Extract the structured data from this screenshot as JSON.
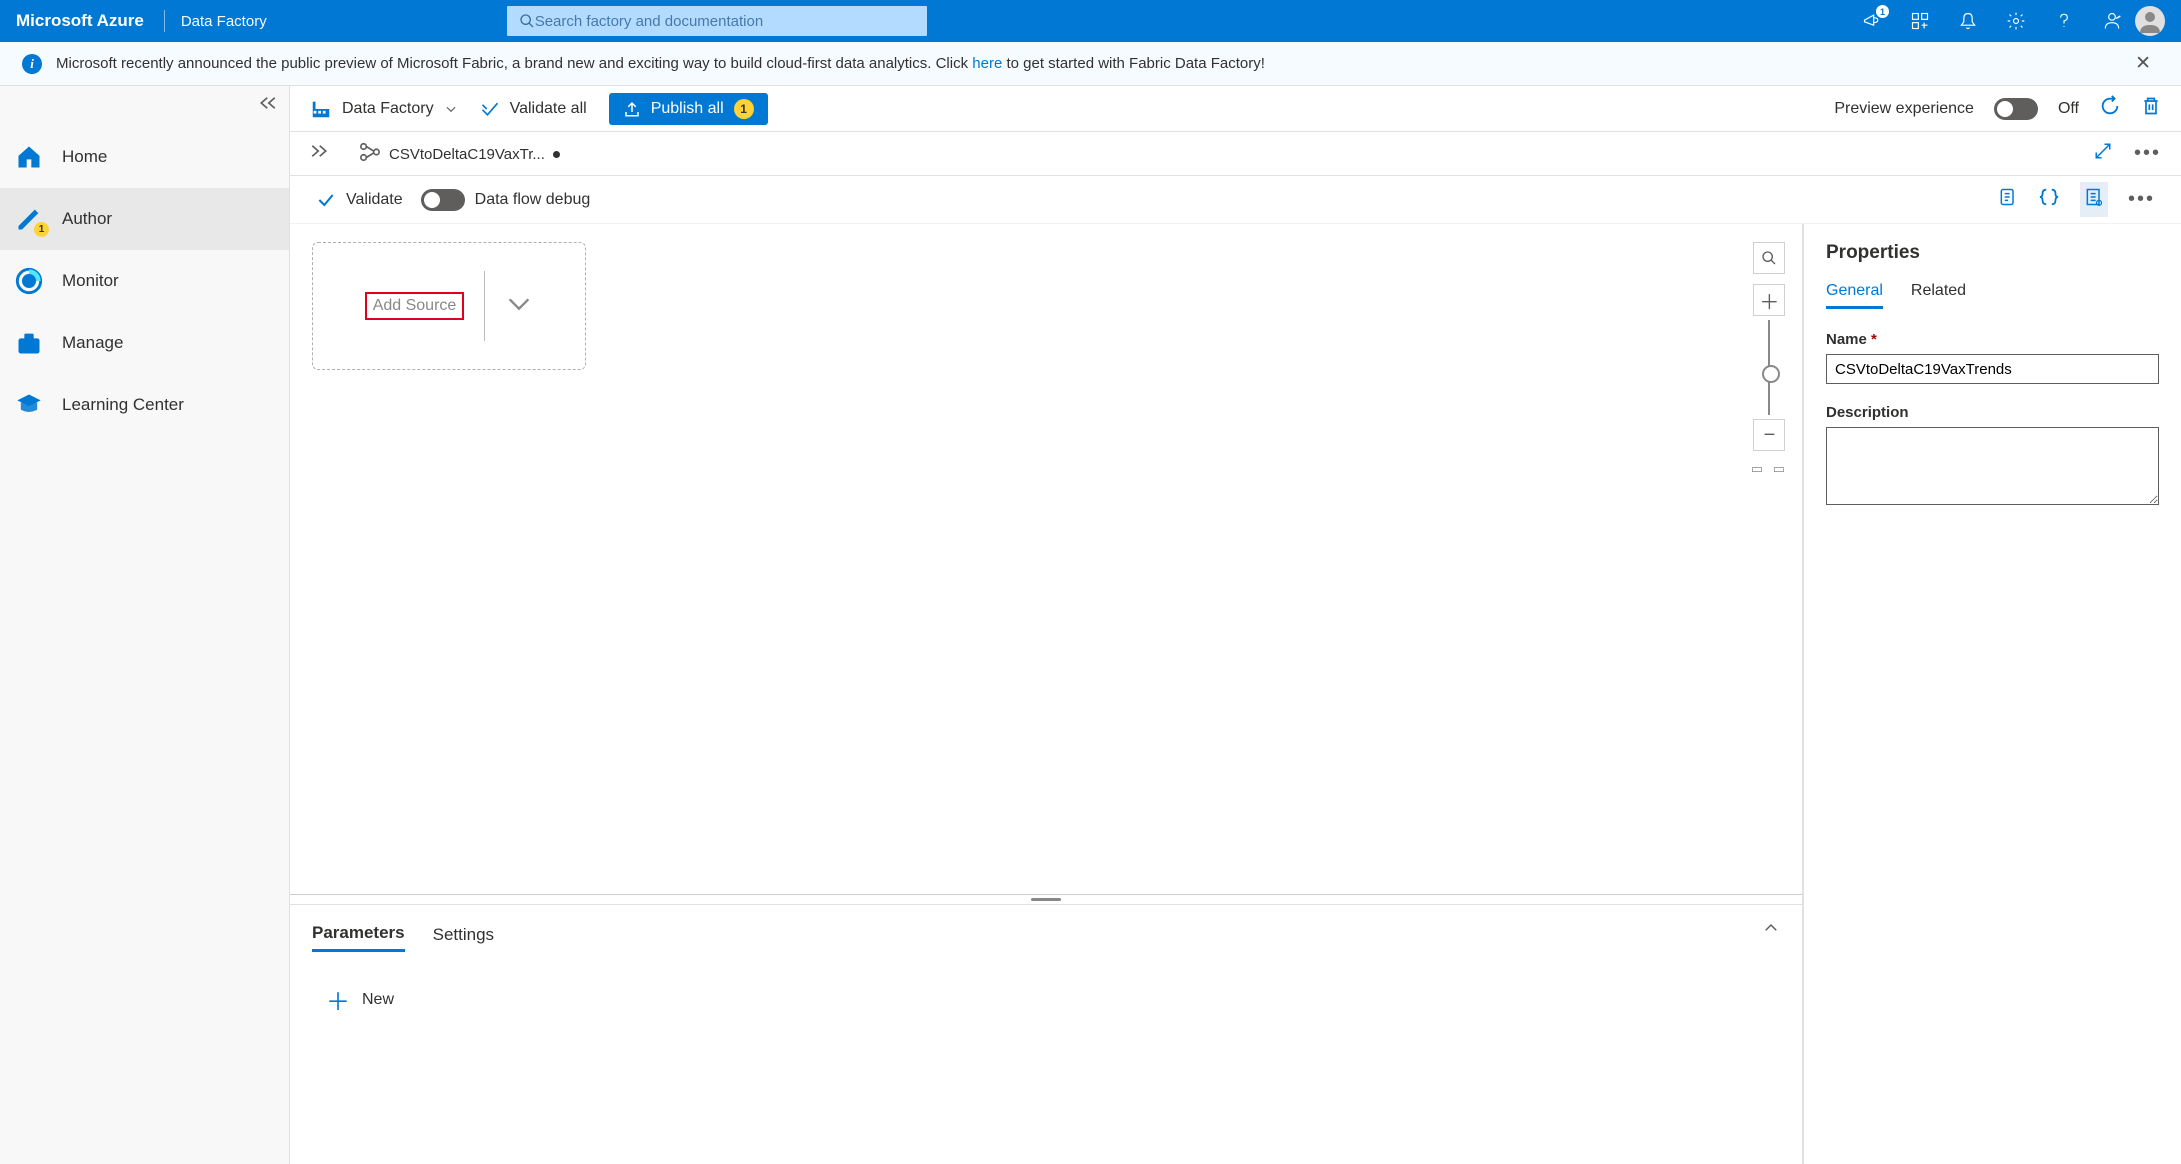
{
  "header": {
    "brand": "Microsoft Azure",
    "product": "Data Factory",
    "search_placeholder": "Search factory and documentation",
    "notification_badge": "1"
  },
  "banner": {
    "text_before": "Microsoft recently announced the public preview of Microsoft Fabric, a brand new and exciting way to build cloud-first data analytics. Click ",
    "link": "here",
    "text_after": " to get started with Fabric Data Factory!"
  },
  "sidebar": {
    "items": [
      {
        "label": "Home"
      },
      {
        "label": "Author",
        "badge": "1"
      },
      {
        "label": "Monitor"
      },
      {
        "label": "Manage"
      },
      {
        "label": "Learning Center"
      }
    ]
  },
  "toolbar": {
    "breadcrumb": "Data Factory",
    "validate_all": "Validate all",
    "publish_all": "Publish all",
    "publish_count": "1",
    "preview_label": "Preview experience",
    "preview_state": "Off"
  },
  "tabs": {
    "active_label": "CSVtoDeltaC19VaxTr..."
  },
  "editor": {
    "validate": "Validate",
    "dataflow_debug": "Data flow debug",
    "add_source": "Add Source"
  },
  "bottom_panel": {
    "tabs": [
      "Parameters",
      "Settings"
    ],
    "new": "New"
  },
  "properties": {
    "title": "Properties",
    "tabs": [
      "General",
      "Related"
    ],
    "name_label": "Name",
    "name_value": "CSVtoDeltaC19VaxTrends",
    "desc_label": "Description"
  }
}
